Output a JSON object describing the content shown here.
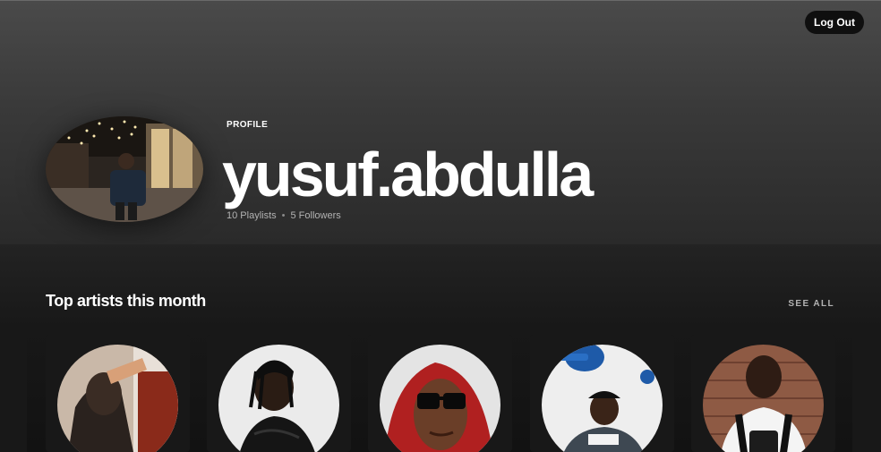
{
  "header": {
    "logout_label": "Log Out",
    "profile_label": "PROFILE",
    "username": "yusuf.abdulla",
    "playlists": "10 Playlists",
    "separator": "•",
    "followers": "5 Followers"
  },
  "top_artists": {
    "title": "Top artists this month",
    "see_all_label": "SEE ALL"
  },
  "colors": {
    "background": "#121212",
    "header_gradient_top": "#4a4a4a",
    "card": "#181818",
    "muted_text": "#b3b3b3"
  }
}
